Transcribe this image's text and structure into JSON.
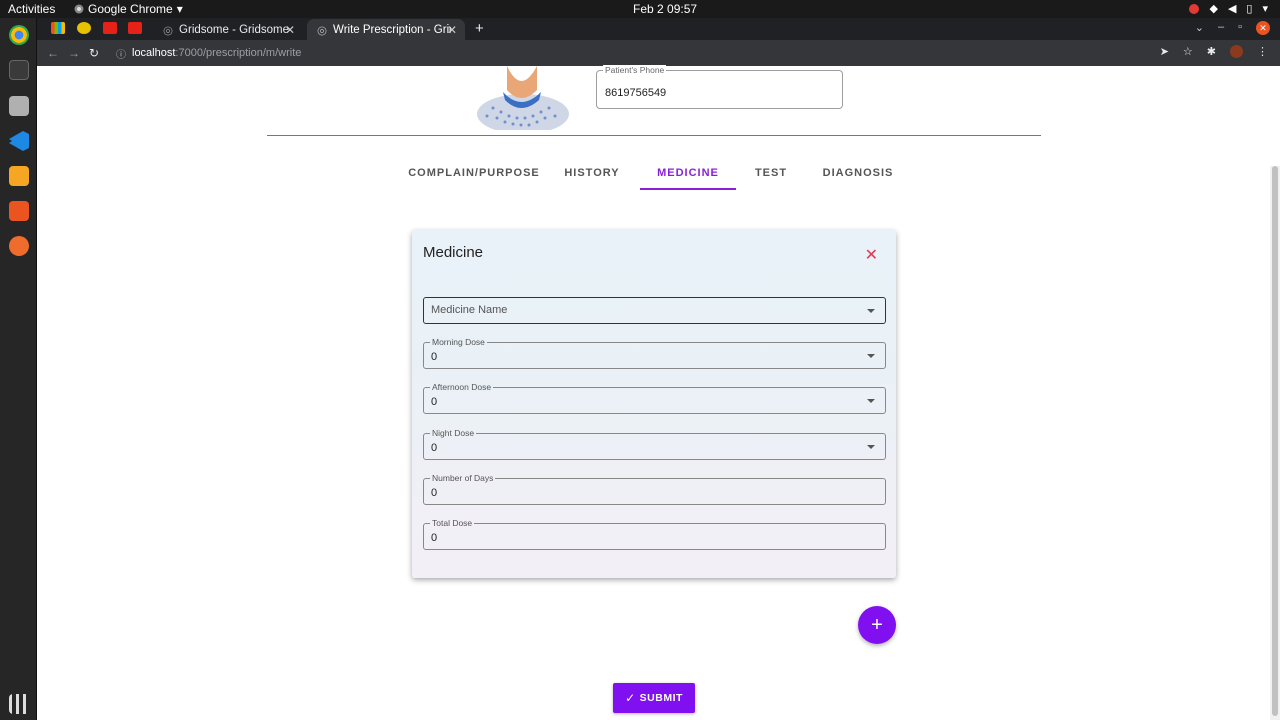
{
  "system": {
    "activities": "Activities",
    "app_name": "Google Chrome",
    "clock": "Feb 2  09:57"
  },
  "browser": {
    "tabs": [
      {
        "label": "Gridsome - Gridsome"
      },
      {
        "label": "Write Prescription - Grids"
      }
    ],
    "url_host": "localhost",
    "url_path": ":7000/prescription/m/write"
  },
  "patient": {
    "phone_label": "Patient's Phone",
    "phone_value": "8619756549"
  },
  "nav_tabs": [
    {
      "label": "COMPLAIN/PURPOSE",
      "active": false
    },
    {
      "label": "HISTORY",
      "active": false
    },
    {
      "label": "MEDICINE",
      "active": true
    },
    {
      "label": "TEST",
      "active": false
    },
    {
      "label": "DIAGNOSIS",
      "active": false
    }
  ],
  "medicine_card": {
    "title": "Medicine",
    "medicine_name_placeholder": "Medicine Name",
    "morning_dose": {
      "label": "Morning Dose",
      "value": "0"
    },
    "afternoon_dose": {
      "label": "Afternoon Dose",
      "value": "0"
    },
    "night_dose": {
      "label": "Night Dose",
      "value": "0"
    },
    "number_of_days": {
      "label": "Number of Days",
      "value": "0"
    },
    "total_dose": {
      "label": "Total Dose",
      "value": "0"
    }
  },
  "actions": {
    "add_icon": "+",
    "submit_label": "SUBMIT"
  },
  "colors": {
    "accent": "#8010f0",
    "close": "#e53950"
  }
}
